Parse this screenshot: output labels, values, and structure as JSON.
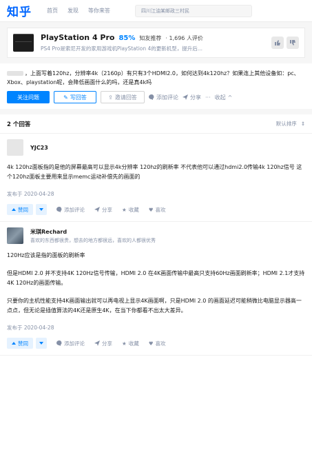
{
  "topnav": {
    "logo": "知乎",
    "links": [
      "首页",
      "发现",
      "等你来答"
    ],
    "search_value": "四川江油某邮政三村民"
  },
  "product": {
    "name": "PlayStation 4 Pro",
    "percent": "85%",
    "recommend_label": "知友推荐",
    "rating_count": "· 1,696 人评价",
    "description": "PS4 Pro是索尼开发的家用游戏机PlayStation 4的更新机型，提升后..."
  },
  "question": {
    "text": "，上面写着120hz，分辨率4k（2160p）有只有3个HDMI2.0，如何达到4k120hz？如果连上其他设备如：pc、Xbox、playstation呢，会降低画面什么的吗，还是真4k吗",
    "follow_label": "关注问题",
    "write_label": "写回答",
    "invite_label": "邀请回答",
    "comment_label": "添加评论",
    "share_label": "分享",
    "more_label": "···",
    "collapse_label": "收起"
  },
  "answers": {
    "count_label": "2 个回答",
    "sort_label": "默认排序",
    "items": [
      {
        "author": "YJC23",
        "bio": "",
        "paragraphs": [
          "4k 120hz面板指的是他的屏幕最高可以显示4k分辨率 120hz的刷新率 不代表他可以通过hdmi2.0传输4k 120hz信号 这个120hz面板主要用来显示memc运动补偿先的画面的"
        ],
        "date": "发布于 2020-04-28",
        "vote_label": "赞同",
        "comment_label": "添加评论",
        "share_label": "分享",
        "favorite_label": "收藏",
        "like_label": "喜欢"
      },
      {
        "author": "米琪Rechard",
        "bio": "喜欢的东西都很贵，想去的地方都很远，喜欢的人都很优秀",
        "paragraphs": [
          "120Hz应该是指的面板的刷新率",
          "但是HDMI 2.0 并不支持4K 120Hz信号传输，HDMI 2.0 在4K画面传输中最高只支持60Hz画面刷新率；HDMI 2.1才支持4K 120Hz的画面传输。",
          "只要你的主机性能支持4K画面输出就可以再电视上显示4K画面啊，只是HDMI 2.0 的画面延迟可能稍微比电脑显示器高一点点，但无论是插值算法的4K还是原生4K，在当下你都看不出太大差异。"
        ],
        "date": "发布于 2020-04-28",
        "vote_label": "赞同",
        "comment_label": "添加评论",
        "share_label": "分享",
        "favorite_label": "收藏",
        "like_label": "喜欢"
      }
    ]
  },
  "colors": {
    "brand": "#0084ff",
    "muted": "#8590a6"
  }
}
